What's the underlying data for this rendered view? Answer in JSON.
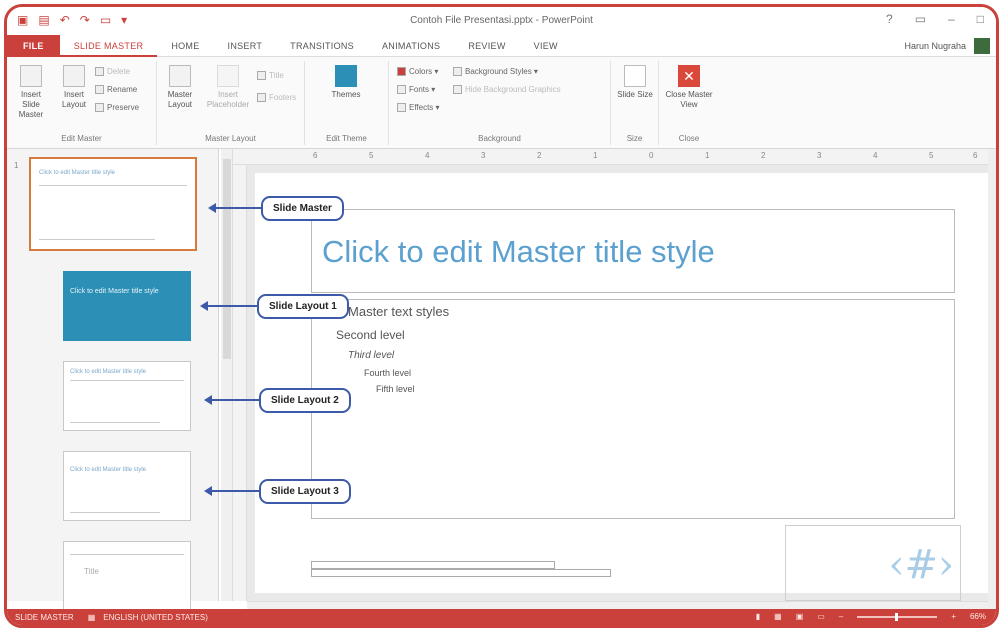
{
  "window": {
    "title": "Contoh File Presentasi.pptx - PowerPoint",
    "qat_icons": [
      "powerpoint-logo-icon",
      "save-icon",
      "undo-icon",
      "redo-icon",
      "start-from-beginning-icon",
      "customize-qat-icon"
    ]
  },
  "tabs": [
    "FILE",
    "SLIDE MASTER",
    "HOME",
    "INSERT",
    "TRANSITIONS",
    "ANIMATIONS",
    "REVIEW",
    "VIEW"
  ],
  "active_tab": "SLIDE MASTER",
  "user": "Harun Nugraha",
  "ribbon": {
    "edit_master": {
      "label": "Edit Master",
      "insert_slide_master": "Insert Slide Master",
      "insert_layout": "Insert Layout",
      "delete": "Delete",
      "rename": "Rename",
      "preserve": "Preserve"
    },
    "master_layout": {
      "label": "Master Layout",
      "master_layout_btn": "Master Layout",
      "insert_placeholder": "Insert Placeholder",
      "title": "Title",
      "footers": "Footers"
    },
    "edit_theme": {
      "label": "Edit Theme",
      "themes": "Themes"
    },
    "background": {
      "label": "Background",
      "colors": "Colors",
      "fonts": "Fonts",
      "effects": "Effects",
      "background_styles": "Background Styles",
      "hide_background_graphics": "Hide Background Graphics"
    },
    "size": {
      "label": "Size",
      "slide_size": "Slide Size"
    },
    "close": {
      "label": "Close",
      "close_master_view": "Close Master View"
    }
  },
  "ruler_numbers": [
    "6",
    "5",
    "4",
    "3",
    "2",
    "1",
    "0",
    "1",
    "2",
    "3",
    "4",
    "5",
    "6"
  ],
  "thumbnails": [
    {
      "number": "1",
      "title": "Click to edit Master title style"
    },
    {
      "title": "Click to edit Master title style"
    },
    {
      "title": "Click to edit Master title style"
    },
    {
      "title": "Click to edit Master title style"
    },
    {
      "title": "Title"
    }
  ],
  "slide": {
    "title": "Click to edit Master title style",
    "levels": [
      "Edit Master text styles",
      "Second level",
      "Third level",
      "Fourth level",
      "Fifth level"
    ],
    "number_glyph": "‹#›"
  },
  "callouts": {
    "slide_master": "Slide Master",
    "layout1": "Slide Layout 1",
    "layout2": "Slide Layout 2",
    "layout3": "Slide Layout 3"
  },
  "status": {
    "mode": "SLIDE MASTER",
    "language": "ENGLISH (UNITED STATES)",
    "zoom": "66%"
  },
  "colors": {
    "accent": "#c9413a",
    "callout": "#3c5aa8",
    "title_text": "#5ba0cf",
    "layout_fill": "#2c8fb5"
  }
}
